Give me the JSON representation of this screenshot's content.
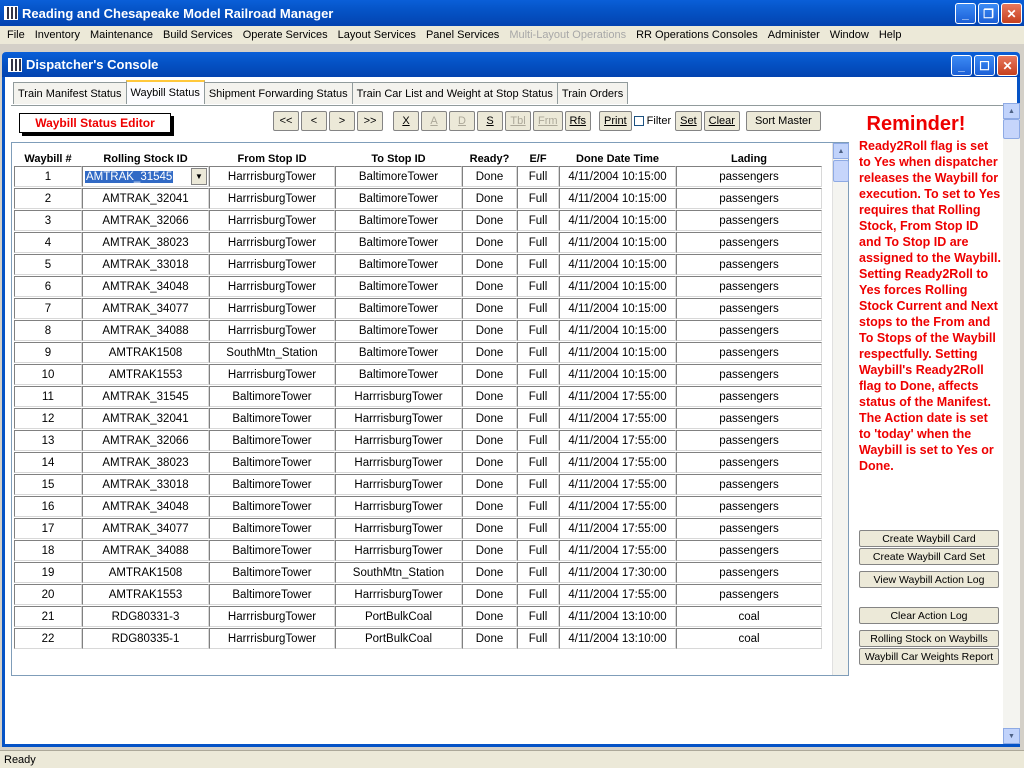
{
  "app": {
    "title": "Reading and Chesapeake Model Railroad Manager"
  },
  "menu": [
    "File",
    "Inventory",
    "Maintenance",
    "Build Services",
    "Operate Services",
    "Layout Services",
    "Panel Services",
    "Multi-Layout Operations",
    "RR Operations Consoles",
    "Administer",
    "Window",
    "Help"
  ],
  "menu_disabled": [
    "Multi-Layout Operations"
  ],
  "window": {
    "title": "Dispatcher's Console"
  },
  "tabs": [
    {
      "label": "Train Manifest Status",
      "active": false
    },
    {
      "label": "Waybill Status",
      "active": true
    },
    {
      "label": "Shipment Forwarding Status",
      "active": false
    },
    {
      "label": "Train Car List and Weight at Stop Status",
      "active": false
    },
    {
      "label": "Train Orders",
      "active": false
    }
  ],
  "editor_label": "Waybill Status Editor",
  "toolbar": {
    "first": "<<",
    "prev": "<",
    "next": ">",
    "last": ">>",
    "x": "X",
    "a": "A",
    "d": "D",
    "s": "S",
    "tbl": "Tbl",
    "frm": "Frm",
    "rfs": "Rfs",
    "print": "Print",
    "filter": "Filter",
    "set": "Set",
    "clear": "Clear",
    "sort_master": "Sort Master"
  },
  "grid": {
    "headers": [
      "Waybill #",
      "Rolling Stock ID",
      "From Stop ID",
      "To Stop ID",
      "Ready?",
      "E/F",
      "Done Date Time",
      "Lading"
    ],
    "rows": [
      [
        "1",
        "AMTRAK_31545",
        "HarrrisburgTower",
        "BaltimoreTower",
        "Done",
        "Full",
        "4/11/2004 10:15:00",
        "passengers"
      ],
      [
        "2",
        "AMTRAK_32041",
        "HarrrisburgTower",
        "BaltimoreTower",
        "Done",
        "Full",
        "4/11/2004 10:15:00",
        "passengers"
      ],
      [
        "3",
        "AMTRAK_32066",
        "HarrrisburgTower",
        "BaltimoreTower",
        "Done",
        "Full",
        "4/11/2004 10:15:00",
        "passengers"
      ],
      [
        "4",
        "AMTRAK_38023",
        "HarrrisburgTower",
        "BaltimoreTower",
        "Done",
        "Full",
        "4/11/2004 10:15:00",
        "passengers"
      ],
      [
        "5",
        "AMTRAK_33018",
        "HarrrisburgTower",
        "BaltimoreTower",
        "Done",
        "Full",
        "4/11/2004 10:15:00",
        "passengers"
      ],
      [
        "6",
        "AMTRAK_34048",
        "HarrrisburgTower",
        "BaltimoreTower",
        "Done",
        "Full",
        "4/11/2004 10:15:00",
        "passengers"
      ],
      [
        "7",
        "AMTRAK_34077",
        "HarrrisburgTower",
        "BaltimoreTower",
        "Done",
        "Full",
        "4/11/2004 10:15:00",
        "passengers"
      ],
      [
        "8",
        "AMTRAK_34088",
        "HarrrisburgTower",
        "BaltimoreTower",
        "Done",
        "Full",
        "4/11/2004 10:15:00",
        "passengers"
      ],
      [
        "9",
        "AMTRAK1508",
        "SouthMtn_Station",
        "BaltimoreTower",
        "Done",
        "Full",
        "4/11/2004 10:15:00",
        "passengers"
      ],
      [
        "10",
        "AMTRAK1553",
        "HarrrisburgTower",
        "BaltimoreTower",
        "Done",
        "Full",
        "4/11/2004 10:15:00",
        "passengers"
      ],
      [
        "11",
        "AMTRAK_31545",
        "BaltimoreTower",
        "HarrrisburgTower",
        "Done",
        "Full",
        "4/11/2004 17:55:00",
        "passengers"
      ],
      [
        "12",
        "AMTRAK_32041",
        "BaltimoreTower",
        "HarrrisburgTower",
        "Done",
        "Full",
        "4/11/2004 17:55:00",
        "passengers"
      ],
      [
        "13",
        "AMTRAK_32066",
        "BaltimoreTower",
        "HarrrisburgTower",
        "Done",
        "Full",
        "4/11/2004 17:55:00",
        "passengers"
      ],
      [
        "14",
        "AMTRAK_38023",
        "BaltimoreTower",
        "HarrrisburgTower",
        "Done",
        "Full",
        "4/11/2004 17:55:00",
        "passengers"
      ],
      [
        "15",
        "AMTRAK_33018",
        "BaltimoreTower",
        "HarrrisburgTower",
        "Done",
        "Full",
        "4/11/2004 17:55:00",
        "passengers"
      ],
      [
        "16",
        "AMTRAK_34048",
        "BaltimoreTower",
        "HarrrisburgTower",
        "Done",
        "Full",
        "4/11/2004 17:55:00",
        "passengers"
      ],
      [
        "17",
        "AMTRAK_34077",
        "BaltimoreTower",
        "HarrrisburgTower",
        "Done",
        "Full",
        "4/11/2004 17:55:00",
        "passengers"
      ],
      [
        "18",
        "AMTRAK_34088",
        "BaltimoreTower",
        "HarrrisburgTower",
        "Done",
        "Full",
        "4/11/2004 17:55:00",
        "passengers"
      ],
      [
        "19",
        "AMTRAK1508",
        "BaltimoreTower",
        "SouthMtn_Station",
        "Done",
        "Full",
        "4/11/2004 17:30:00",
        "passengers"
      ],
      [
        "20",
        "AMTRAK1553",
        "BaltimoreTower",
        "HarrrisburgTower",
        "Done",
        "Full",
        "4/11/2004 17:55:00",
        "passengers"
      ],
      [
        "21",
        "RDG80331-3",
        "HarrrisburgTower",
        "PortBulkCoal",
        "Done",
        "Full",
        "4/11/2004 13:10:00",
        "coal"
      ],
      [
        "22",
        "RDG80335-1",
        "HarrrisburgTower",
        "PortBulkCoal",
        "Done",
        "Full",
        "4/11/2004 13:10:00",
        "coal"
      ]
    ]
  },
  "reminder": {
    "title": "Reminder!",
    "text": "Ready2Roll flag is set to Yes when dispatcher releases the Waybill for execution. To set to Yes requires that Rolling Stock, From Stop ID and To Stop ID are assigned to the Waybill. Setting Ready2Roll to Yes forces Rolling Stock Current and Next stops to the From and To Stops of the Waybill respectfully. Setting Waybill's Ready2Roll flag to Done, affects status of the Manifest. The Action date is set to 'today' when the Waybill is set to Yes or Done."
  },
  "side_buttons": {
    "create_card": "Create Waybill Card",
    "create_card_set": "Create Waybill Card Set",
    "view_action_log": "View Waybill Action Log",
    "clear_action_log": "Clear Action Log",
    "rolling_stock": "Rolling Stock on Waybills",
    "car_weights": "Waybill Car Weights Report"
  },
  "status": {
    "text": "Ready"
  },
  "colors": {
    "title_blue": "#0553c6",
    "reminder_red": "#e00000",
    "selection": "#316ac5"
  }
}
